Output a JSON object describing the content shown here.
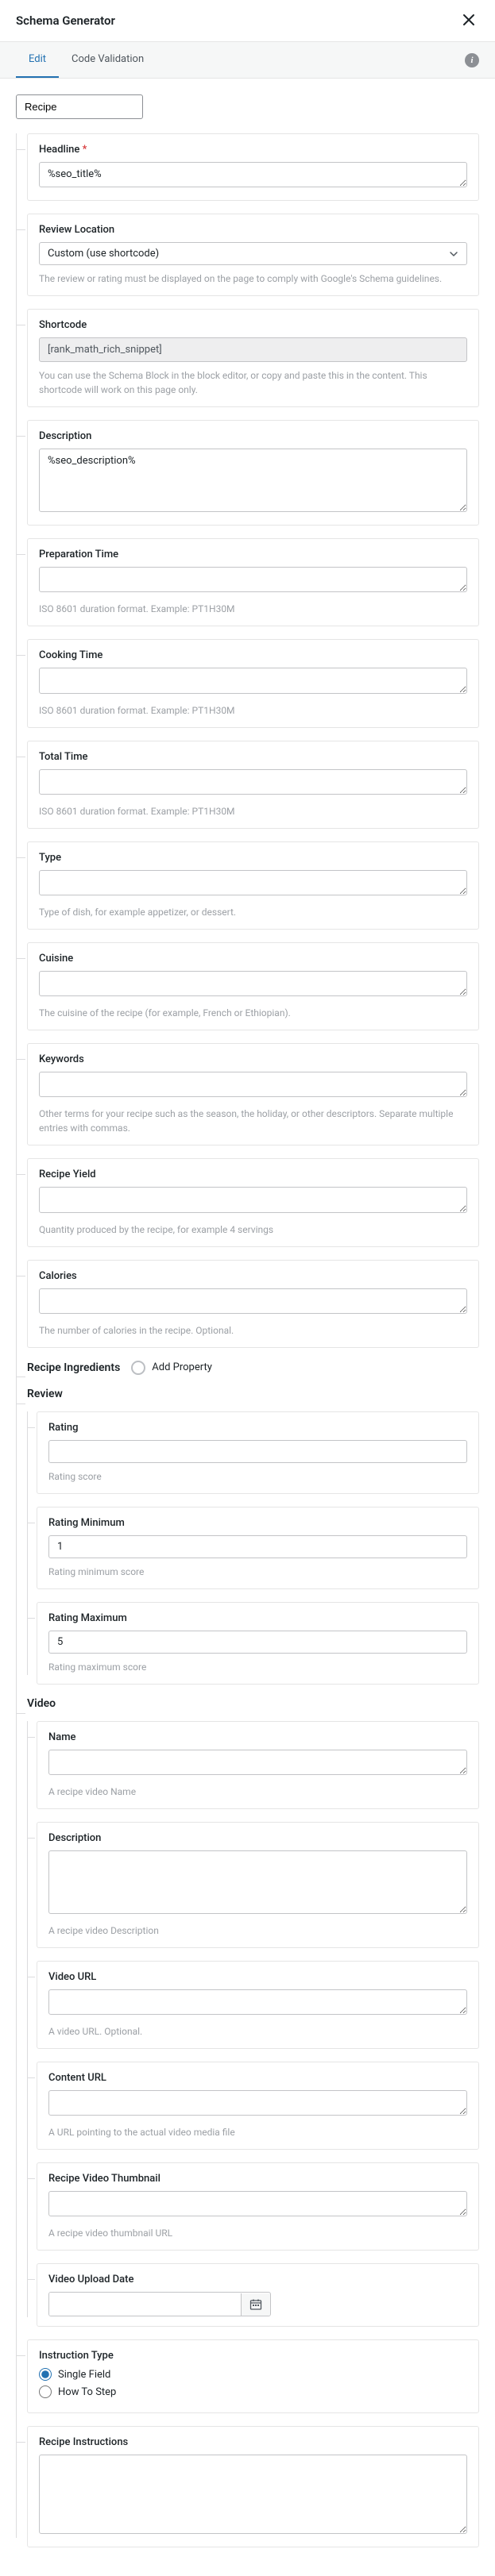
{
  "header": {
    "title": "Schema Generator"
  },
  "tabs": {
    "edit": "Edit",
    "code": "Code Validation"
  },
  "schema_type": "Recipe",
  "fields": {
    "headline": {
      "label": "Headline",
      "value": "%seo_title%"
    },
    "review_location": {
      "label": "Review Location",
      "selected": "Custom (use shortcode)",
      "help": "The review or rating must be displayed on the page to comply with Google's Schema guidelines."
    },
    "shortcode": {
      "label": "Shortcode",
      "value": "[rank_math_rich_snippet]",
      "help": "You can use the Schema Block in the block editor, or copy and paste this in the content. This shortcode will work on this page only."
    },
    "description": {
      "label": "Description",
      "value": "%seo_description%"
    },
    "prep_time": {
      "label": "Preparation Time",
      "help": "ISO 8601 duration format. Example: PT1H30M"
    },
    "cook_time": {
      "label": "Cooking Time",
      "help": "ISO 8601 duration format. Example: PT1H30M"
    },
    "total_time": {
      "label": "Total Time",
      "help": "ISO 8601 duration format. Example: PT1H30M"
    },
    "type": {
      "label": "Type",
      "help": "Type of dish, for example appetizer, or dessert."
    },
    "cuisine": {
      "label": "Cuisine",
      "help": "The cuisine of the recipe (for example, French or Ethiopian)."
    },
    "keywords": {
      "label": "Keywords",
      "help": "Other terms for your recipe such as the season, the holiday, or other descriptors. Separate multiple entries with commas."
    },
    "yield": {
      "label": "Recipe Yield",
      "help": "Quantity produced by the recipe, for example 4 servings"
    },
    "calories": {
      "label": "Calories",
      "help": "The number of calories in the recipe. Optional."
    }
  },
  "sections": {
    "ingredients": {
      "label": "Recipe Ingredients",
      "add_label": "Add Property"
    },
    "review": {
      "label": "Review",
      "rating": {
        "label": "Rating",
        "help": "Rating score"
      },
      "min": {
        "label": "Rating Minimum",
        "value": "1",
        "help": "Rating minimum score"
      },
      "max": {
        "label": "Rating Maximum",
        "value": "5",
        "help": "Rating maximum score"
      }
    },
    "video": {
      "label": "Video",
      "name": {
        "label": "Name",
        "help": "A recipe video Name"
      },
      "desc": {
        "label": "Description",
        "help": "A recipe video Description"
      },
      "url": {
        "label": "Video URL",
        "help": "A video URL. Optional."
      },
      "content_url": {
        "label": "Content URL",
        "help": "A URL pointing to the actual video media file"
      },
      "thumbnail": {
        "label": "Recipe Video Thumbnail",
        "help": "A recipe video thumbnail URL"
      },
      "upload_date": {
        "label": "Video Upload Date"
      }
    },
    "instruction_type": {
      "label": "Instruction Type",
      "opt1": "Single Field",
      "opt2": "How To Step"
    },
    "instructions": {
      "label": "Recipe Instructions"
    }
  }
}
